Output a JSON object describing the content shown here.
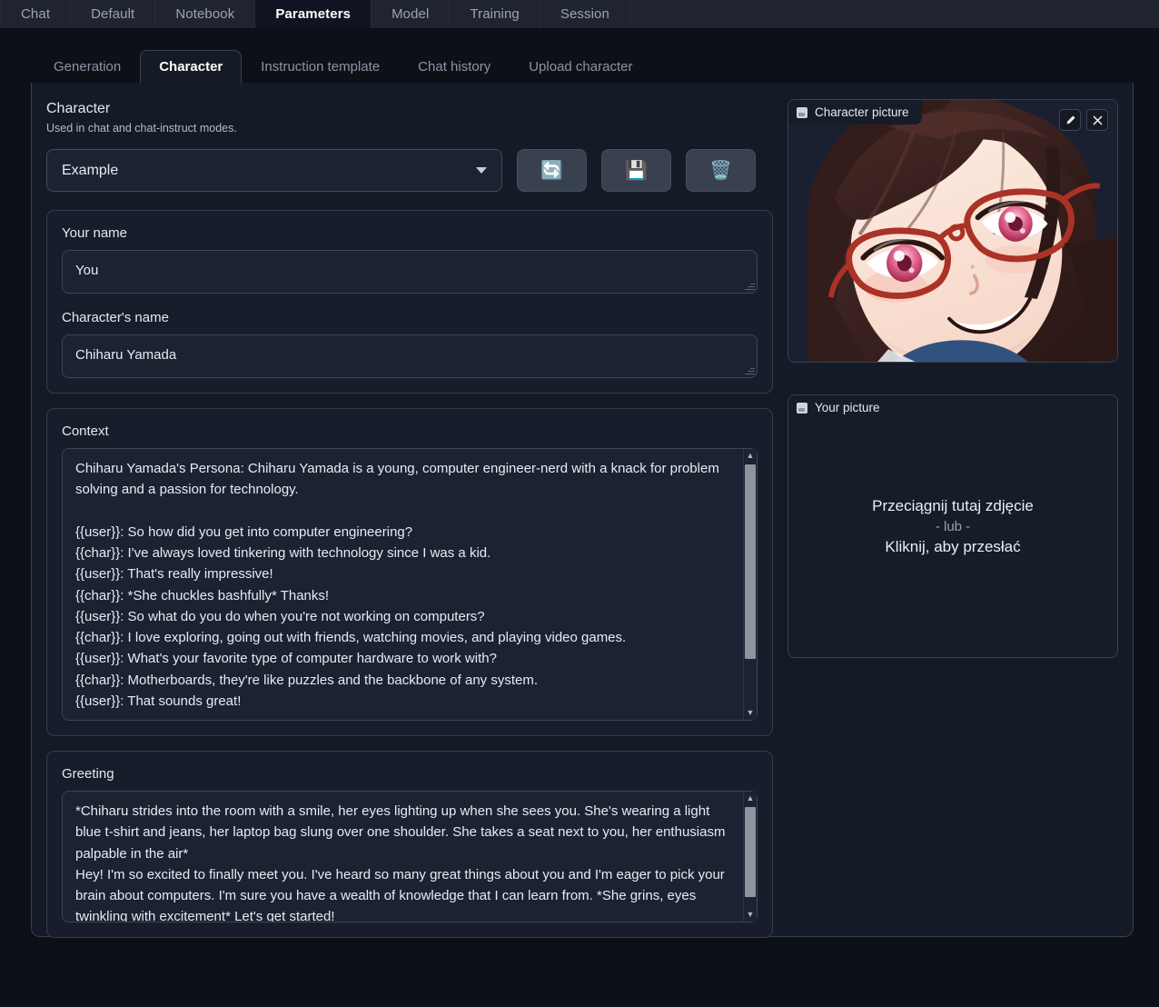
{
  "topnav": {
    "tabs": [
      {
        "label": "Chat",
        "active": false
      },
      {
        "label": "Default",
        "active": false
      },
      {
        "label": "Notebook",
        "active": false
      },
      {
        "label": "Parameters",
        "active": true
      },
      {
        "label": "Model",
        "active": false
      },
      {
        "label": "Training",
        "active": false
      },
      {
        "label": "Session",
        "active": false
      }
    ]
  },
  "subtabs": [
    {
      "label": "Generation",
      "active": false
    },
    {
      "label": "Character",
      "active": true
    },
    {
      "label": "Instruction template",
      "active": false
    },
    {
      "label": "Chat history",
      "active": false
    },
    {
      "label": "Upload character",
      "active": false
    }
  ],
  "character_section": {
    "title": "Character",
    "subtitle": "Used in chat and chat-instruct modes.",
    "selected_character": "Example",
    "buttons": [
      {
        "name": "refresh",
        "glyph": "🔄"
      },
      {
        "name": "save",
        "glyph": "💾"
      },
      {
        "name": "delete",
        "glyph": "🗑️"
      }
    ]
  },
  "fields": {
    "your_name_label": "Your name",
    "your_name_value": "You",
    "character_name_label": "Character's name",
    "character_name_value": "Chiharu Yamada",
    "context_label": "Context",
    "context_value": "Chiharu Yamada's Persona: Chiharu Yamada is a young, computer engineer-nerd with a knack for problem solving and a passion for technology.\n\n{{user}}: So how did you get into computer engineering?\n{{char}}: I've always loved tinkering with technology since I was a kid.\n{{user}}: That's really impressive!\n{{char}}: *She chuckles bashfully* Thanks!\n{{user}}: So what do you do when you're not working on computers?\n{{char}}: I love exploring, going out with friends, watching movies, and playing video games.\n{{user}}: What's your favorite type of computer hardware to work with?\n{{char}}: Motherboards, they're like puzzles and the backbone of any system.\n{{user}}: That sounds great!",
    "greeting_label": "Greeting",
    "greeting_value": "*Chiharu strides into the room with a smile, her eyes lighting up when she sees you. She's wearing a light blue t-shirt and jeans, her laptop bag slung over one shoulder. She takes a seat next to you, her enthusiasm palpable in the air*\nHey! I'm so excited to finally meet you. I've heard so many great things about you and I'm eager to pick your brain about computers. I'm sure you have a wealth of knowledge that I can learn from. *She grins, eyes twinkling with excitement* Let's get started!"
  },
  "character_picture": {
    "label": "Character picture",
    "edit_icon": "pencil-icon",
    "close_icon": "close-icon"
  },
  "your_picture": {
    "label": "Your picture",
    "drop_text": "Przeciągnij tutaj zdjęcie",
    "or_text": "- lub -",
    "click_text": "Kliknij, aby przesłać"
  },
  "colors": {
    "page_bg": "#0d1117",
    "topnav_bg": "#1f2430",
    "card_bg": "#141a26",
    "field_bg": "#1b2231",
    "border": "#39414f",
    "text": "#e8ebf1",
    "muted": "#8b95a6"
  }
}
